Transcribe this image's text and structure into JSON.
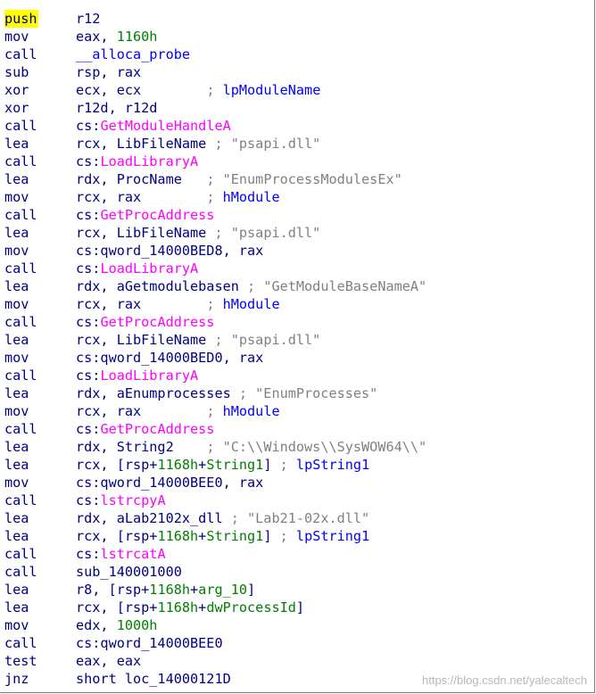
{
  "lines": [
    {
      "mnemonic": "push",
      "highlight": true,
      "parts": [
        {
          "t": "r12",
          "c": "lbl"
        }
      ]
    },
    {
      "mnemonic": "mov",
      "parts": [
        {
          "t": "eax, ",
          "c": "lbl"
        },
        {
          "t": "1160h",
          "c": "num"
        }
      ]
    },
    {
      "mnemonic": "call",
      "parts": [
        {
          "t": "__alloca_probe",
          "c": "named"
        }
      ]
    },
    {
      "mnemonic": "sub",
      "parts": [
        {
          "t": "rsp, rax",
          "c": "lbl"
        }
      ]
    },
    {
      "mnemonic": "xor",
      "parts": [
        {
          "t": "ecx, ecx        ",
          "c": "lbl"
        },
        {
          "t": "; ",
          "c": "cmt"
        },
        {
          "t": "lpModuleName",
          "c": "cmtname"
        }
      ]
    },
    {
      "mnemonic": "xor",
      "parts": [
        {
          "t": "r12d, r12d",
          "c": "lbl"
        }
      ]
    },
    {
      "mnemonic": "call",
      "parts": [
        {
          "t": "cs:",
          "c": "lbl"
        },
        {
          "t": "GetModuleHandleA",
          "c": "func"
        }
      ]
    },
    {
      "mnemonic": "lea",
      "parts": [
        {
          "t": "rcx, LibFileName ",
          "c": "lbl"
        },
        {
          "t": "; \"psapi.dll\"",
          "c": "cmt"
        }
      ]
    },
    {
      "mnemonic": "call",
      "parts": [
        {
          "t": "cs:",
          "c": "lbl"
        },
        {
          "t": "LoadLibraryA",
          "c": "func"
        }
      ]
    },
    {
      "mnemonic": "lea",
      "parts": [
        {
          "t": "rdx, ProcName   ",
          "c": "lbl"
        },
        {
          "t": "; \"EnumProcessModulesEx\"",
          "c": "cmt"
        }
      ]
    },
    {
      "mnemonic": "mov",
      "parts": [
        {
          "t": "rcx, rax        ",
          "c": "lbl"
        },
        {
          "t": "; ",
          "c": "cmt"
        },
        {
          "t": "hModule",
          "c": "cmtname"
        }
      ]
    },
    {
      "mnemonic": "call",
      "parts": [
        {
          "t": "cs:",
          "c": "lbl"
        },
        {
          "t": "GetProcAddress",
          "c": "func"
        }
      ]
    },
    {
      "mnemonic": "lea",
      "parts": [
        {
          "t": "rcx, LibFileName ",
          "c": "lbl"
        },
        {
          "t": "; \"psapi.dll\"",
          "c": "cmt"
        }
      ]
    },
    {
      "mnemonic": "mov",
      "parts": [
        {
          "t": "cs:qword_14000BED8, rax",
          "c": "lbl"
        }
      ]
    },
    {
      "mnemonic": "call",
      "parts": [
        {
          "t": "cs:",
          "c": "lbl"
        },
        {
          "t": "LoadLibraryA",
          "c": "func"
        }
      ]
    },
    {
      "mnemonic": "lea",
      "parts": [
        {
          "t": "rdx, aGetmodulebasen ",
          "c": "lbl"
        },
        {
          "t": "; \"GetModuleBaseNameA\"",
          "c": "cmt"
        }
      ]
    },
    {
      "mnemonic": "mov",
      "parts": [
        {
          "t": "rcx, rax        ",
          "c": "lbl"
        },
        {
          "t": "; ",
          "c": "cmt"
        },
        {
          "t": "hModule",
          "c": "cmtname"
        }
      ]
    },
    {
      "mnemonic": "call",
      "parts": [
        {
          "t": "cs:",
          "c": "lbl"
        },
        {
          "t": "GetProcAddress",
          "c": "func"
        }
      ]
    },
    {
      "mnemonic": "lea",
      "parts": [
        {
          "t": "rcx, LibFileName ",
          "c": "lbl"
        },
        {
          "t": "; \"psapi.dll\"",
          "c": "cmt"
        }
      ]
    },
    {
      "mnemonic": "mov",
      "parts": [
        {
          "t": "cs:qword_14000BED0, rax",
          "c": "lbl"
        }
      ]
    },
    {
      "mnemonic": "call",
      "parts": [
        {
          "t": "cs:",
          "c": "lbl"
        },
        {
          "t": "LoadLibraryA",
          "c": "func"
        }
      ]
    },
    {
      "mnemonic": "lea",
      "parts": [
        {
          "t": "rdx, aEnumprocesses ",
          "c": "lbl"
        },
        {
          "t": "; \"EnumProcesses\"",
          "c": "cmt"
        }
      ]
    },
    {
      "mnemonic": "mov",
      "parts": [
        {
          "t": "rcx, rax        ",
          "c": "lbl"
        },
        {
          "t": "; ",
          "c": "cmt"
        },
        {
          "t": "hModule",
          "c": "cmtname"
        }
      ]
    },
    {
      "mnemonic": "call",
      "parts": [
        {
          "t": "cs:",
          "c": "lbl"
        },
        {
          "t": "GetProcAddress",
          "c": "func"
        }
      ]
    },
    {
      "mnemonic": "lea",
      "parts": [
        {
          "t": "rdx, String2    ",
          "c": "lbl"
        },
        {
          "t": "; \"C:\\\\Windows\\\\SysWOW64\\\\\"",
          "c": "cmt"
        }
      ]
    },
    {
      "mnemonic": "lea",
      "parts": [
        {
          "t": "rcx, [rsp+",
          "c": "lbl"
        },
        {
          "t": "1168h",
          "c": "num"
        },
        {
          "t": "+",
          "c": "lbl"
        },
        {
          "t": "String1",
          "c": "num"
        },
        {
          "t": "] ",
          "c": "lbl"
        },
        {
          "t": "; ",
          "c": "cmt"
        },
        {
          "t": "lpString1",
          "c": "cmtname"
        }
      ]
    },
    {
      "mnemonic": "mov",
      "parts": [
        {
          "t": "cs:qword_14000BEE0, rax",
          "c": "lbl"
        }
      ]
    },
    {
      "mnemonic": "call",
      "parts": [
        {
          "t": "cs:",
          "c": "lbl"
        },
        {
          "t": "lstrcpyA",
          "c": "func"
        }
      ]
    },
    {
      "mnemonic": "lea",
      "parts": [
        {
          "t": "rdx, aLab2102x_dll ",
          "c": "lbl"
        },
        {
          "t": "; \"Lab21-02x.dll\"",
          "c": "cmt"
        }
      ]
    },
    {
      "mnemonic": "lea",
      "parts": [
        {
          "t": "rcx, [rsp+",
          "c": "lbl"
        },
        {
          "t": "1168h",
          "c": "num"
        },
        {
          "t": "+",
          "c": "lbl"
        },
        {
          "t": "String1",
          "c": "num"
        },
        {
          "t": "] ",
          "c": "lbl"
        },
        {
          "t": "; ",
          "c": "cmt"
        },
        {
          "t": "lpString1",
          "c": "cmtname"
        }
      ]
    },
    {
      "mnemonic": "call",
      "parts": [
        {
          "t": "cs:",
          "c": "lbl"
        },
        {
          "t": "lstrcatA",
          "c": "func"
        }
      ]
    },
    {
      "mnemonic": "call",
      "parts": [
        {
          "t": "sub_140001000",
          "c": "lbl"
        }
      ]
    },
    {
      "mnemonic": "lea",
      "parts": [
        {
          "t": "r8, [rsp+",
          "c": "lbl"
        },
        {
          "t": "1168h",
          "c": "num"
        },
        {
          "t": "+",
          "c": "lbl"
        },
        {
          "t": "arg_10",
          "c": "num"
        },
        {
          "t": "]",
          "c": "lbl"
        }
      ]
    },
    {
      "mnemonic": "lea",
      "parts": [
        {
          "t": "rcx, [rsp+",
          "c": "lbl"
        },
        {
          "t": "1168h",
          "c": "num"
        },
        {
          "t": "+",
          "c": "lbl"
        },
        {
          "t": "dwProcessId",
          "c": "num"
        },
        {
          "t": "]",
          "c": "lbl"
        }
      ]
    },
    {
      "mnemonic": "mov",
      "parts": [
        {
          "t": "edx, ",
          "c": "lbl"
        },
        {
          "t": "1000h",
          "c": "num"
        }
      ]
    },
    {
      "mnemonic": "call",
      "parts": [
        {
          "t": "cs:qword_14000BEE0",
          "c": "lbl"
        }
      ]
    },
    {
      "mnemonic": "test",
      "parts": [
        {
          "t": "eax, eax",
          "c": "lbl"
        }
      ]
    },
    {
      "mnemonic": "jnz",
      "parts": [
        {
          "t": "short loc_14000121D",
          "c": "lbl"
        }
      ]
    }
  ],
  "watermark": "https://blog.csdn.net/yalecaltech",
  "colors": {
    "default": "#000080",
    "number": "#008000",
    "import": "#ff00ff",
    "named": "#0000ff",
    "comment": "#808080",
    "highlight": "#ffff00"
  }
}
